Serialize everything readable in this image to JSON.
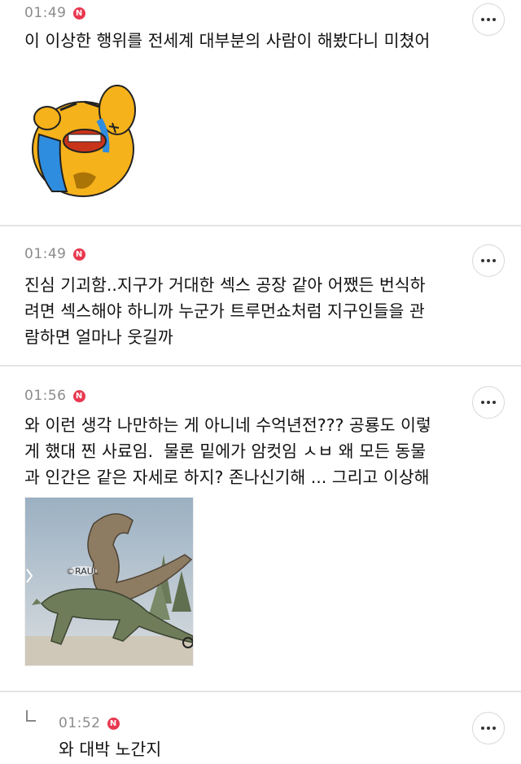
{
  "comments": [
    {
      "time": "01:49",
      "badge": "N",
      "text": "이 이상한 행위를 전세계 대부분의 사람이 해봤다니 미쳤어",
      "attachment": "crying-bear-emoticon"
    },
    {
      "time": "01:49",
      "badge": "N",
      "text": "진심 기괴함..지구가 거대한 섹스 공장 같아 어쨌든 번식하\n려면 섹스해야 하니까 누군가 트루먼쇼처럼 지구인들을 관\n람하면 얼마나 웃길까"
    },
    {
      "time": "01:56",
      "badge": "N",
      "text": "와 이런 생각 나만하는 게 아니네 수억년전??? 공룡도 이렇\n게 했대 찐 사료임.  물론 밑에가 암컷임 ㅅㅂ 왜 모든 동물\n과 인간은 같은 자세로 하지? 존나신기해 ... 그리고 이상해",
      "attachment": "dinosaur-image",
      "watermark": "©RAUL"
    }
  ],
  "reply": {
    "time": "01:52",
    "badge": "N",
    "text": "와 대박 노간지"
  },
  "colors": {
    "badge": "#e8384f",
    "time": "#8c8c8c",
    "separator": "#e4e4e4"
  }
}
